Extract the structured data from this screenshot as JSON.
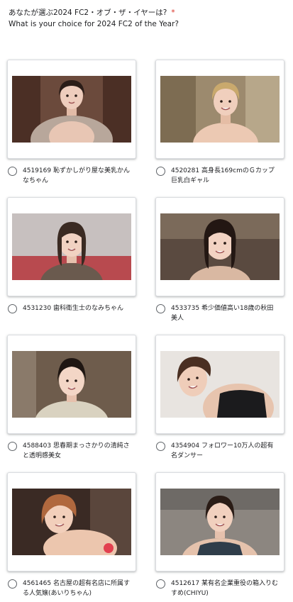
{
  "question": {
    "title_ja": "あなたが選ぶ2024 FC2・オブ・ザ・イヤーは?",
    "required_mark": "*",
    "title_en": "What is your choice for 2024 FC2 of the Year?"
  },
  "options": [
    {
      "label": "4519169 恥ずかしがり屋な美乳かんなちゃん",
      "selected": false
    },
    {
      "label": "4520281 高身長169cmのＧカップ巨乳白ギャル",
      "selected": false
    },
    {
      "label": "4531230 歯科衛生士のなみちゃん",
      "selected": false
    },
    {
      "label": "4533735 希少価値高い18歳の秋田美人",
      "selected": false
    },
    {
      "label": "4588403 思春期まっさかりの清純さと透明感美女",
      "selected": false
    },
    {
      "label": "4354904 フォロワー10万人の超有名ダンサー",
      "selected": false
    },
    {
      "label": "4561465 名古屋の超有名店に所属する人気嬢(あいりちゃん)",
      "selected": false
    },
    {
      "label": "4512617 某有名企業重役の箱入りむすめ(CHIYU)",
      "selected": false
    }
  ],
  "colors": {
    "required": "#d93025",
    "text": "#202124",
    "radio_border": "#5f6368",
    "card_border": "#dadce0"
  }
}
